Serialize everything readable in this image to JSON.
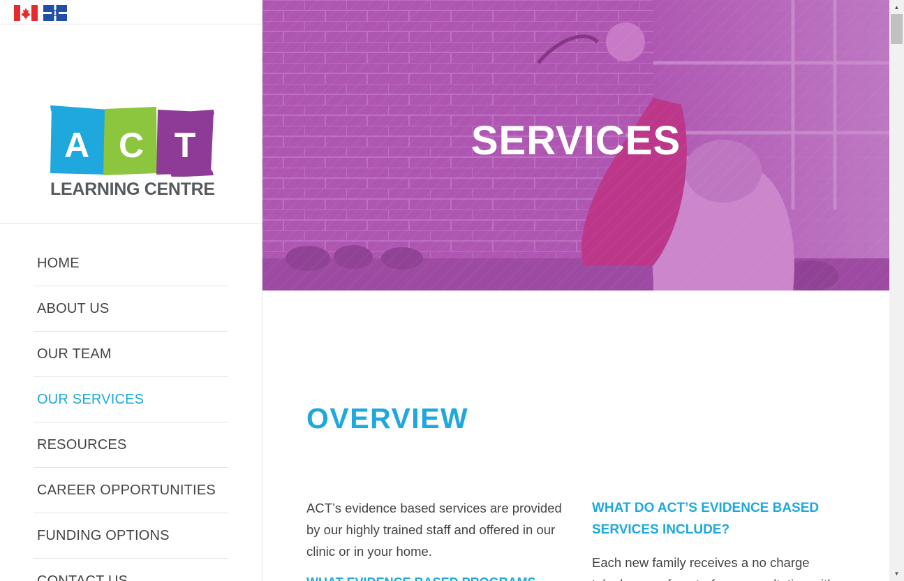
{
  "flags": [
    "canada-flag",
    "quebec-flag"
  ],
  "logo": {
    "letters": [
      "A",
      "C",
      "T"
    ],
    "tagline": "LEARNING CENTRE"
  },
  "nav": [
    {
      "label": "HOME",
      "active": false
    },
    {
      "label": "ABOUT US",
      "active": false
    },
    {
      "label": "OUR TEAM",
      "active": false
    },
    {
      "label": "OUR SERVICES",
      "active": true
    },
    {
      "label": "RESOURCES",
      "active": false
    },
    {
      "label": "CAREER OPPORTUNITIES",
      "active": false
    },
    {
      "label": "FUNDING OPTIONS",
      "active": false
    },
    {
      "label": "CONTACT US",
      "active": false
    }
  ],
  "hero": {
    "title": "SERVICES"
  },
  "overview": {
    "title": "OVERVIEW",
    "left_text": "ACT’s evidence based services are provided by our highly trained staff and offered in our clinic or in your home.",
    "left_subheading": "WHAT EVIDENCE BASED PROGRAMS",
    "right_heading": "WHAT DO ACT’S EVIDENCE BASED SERVICES INCLUDE?",
    "right_text": "Each new family receives a no charge telephone or face-to-face consultation with"
  },
  "colors": {
    "accent": "#1ea8de",
    "hero_overlay": "#a24aa8",
    "logo_blue": "#1ea8de",
    "logo_green": "#8cc63f",
    "logo_purple": "#8e3a97"
  }
}
